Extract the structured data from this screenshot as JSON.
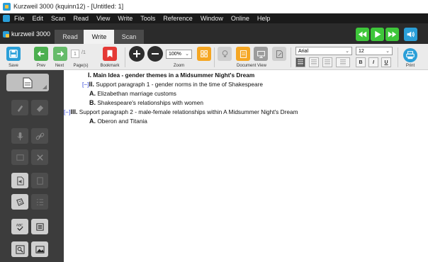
{
  "window": {
    "title": "Kurzweil 3000 (kquinn12) - [Untitled: 1]"
  },
  "menu": [
    "File",
    "Edit",
    "Scan",
    "Read",
    "View",
    "Write",
    "Tools",
    "Reference",
    "Window",
    "Online",
    "Help"
  ],
  "brand": {
    "label": "kurzweil 3000"
  },
  "tabs": {
    "read": "Read",
    "write": "Write",
    "scan": "Scan",
    "active": "write"
  },
  "toolbar": {
    "save": "Save",
    "prev": "Prev",
    "next": "Next",
    "page_current": "1",
    "page_total": "/1",
    "pages": "Page(s)",
    "bookmark": "Bookmark",
    "zoom": "Zoom",
    "zoom_value": "100%",
    "document_view": "Document View",
    "font": "Arial",
    "font_size": "12",
    "bold": "B",
    "italic": "I",
    "underline": "U",
    "print": "Print"
  },
  "outline": {
    "main": {
      "numeral": "I.",
      "text": "Main Idea - gender themes in a Midsummer Night's Dream"
    },
    "p1": {
      "collapse": "[−]",
      "numeral": "II.",
      "text": "Support paragraph 1 - gender norms in the time of Shakespeare"
    },
    "p1a": {
      "numeral": "A.",
      "text": "Elizabethan marriage customs"
    },
    "p1b": {
      "numeral": "B.",
      "text": "Shakespeare's relationships with women"
    },
    "p2": {
      "collapse": "[−]",
      "numeral": "III.",
      "text": "Support paragraph 2 - male-female relationships within A Midsummer Night's Dream"
    },
    "p2a": {
      "numeral": "A.",
      "text": "Oberon and Titania"
    }
  },
  "colors": {
    "accent_blue": "#2a9fd8",
    "play_green": "#3ec63a",
    "bookmark_red": "#e53935",
    "sidebar": "#3c3c3c"
  }
}
